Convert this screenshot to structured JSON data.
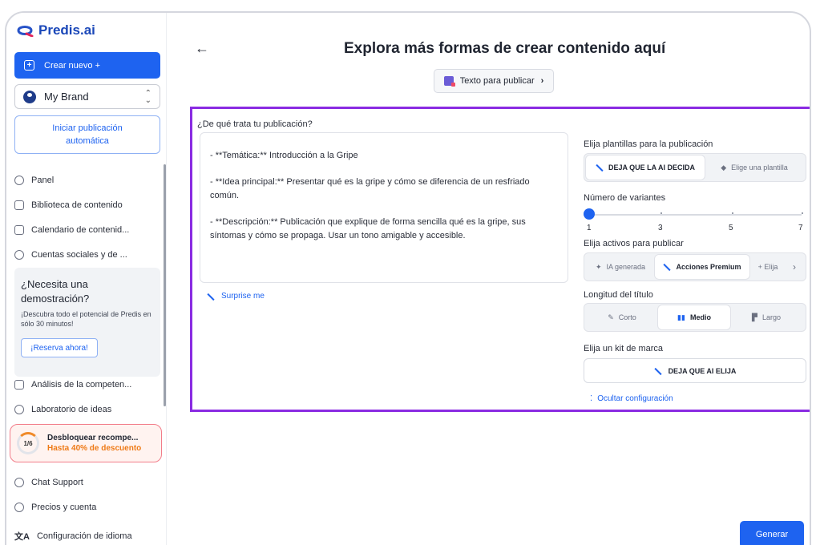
{
  "app": {
    "logo_text": "Predis.ai"
  },
  "sidebar": {
    "create_button": "Crear nuevo +",
    "brand": "My Brand",
    "auto_post": "Iniciar publicación automática",
    "items": [
      {
        "label": "Panel",
        "icon": "home-icon"
      },
      {
        "label": "Biblioteca de contenido",
        "icon": "folder-icon"
      },
      {
        "label": "Calendario de contenid...",
        "icon": "calendar-icon"
      },
      {
        "label": "Cuentas sociales y de ...",
        "icon": "accounts-icon"
      }
    ],
    "demo": {
      "title": "¿Necesita una demostración?",
      "subtitle": "¡Descubra todo el potencial de Predis en sólo 30 minutos!",
      "button": "¡Reserva ahora!"
    },
    "items2": [
      {
        "label": "Análisis de la competen...",
        "icon": "chart-icon"
      },
      {
        "label": "Laboratorio de ideas",
        "icon": "lab-icon"
      }
    ],
    "reward": {
      "progress": "1/6",
      "title": "Desbloquear recompe...",
      "subtitle": "Hasta 40% de descuento"
    },
    "items3": [
      {
        "label": "Chat Support",
        "icon": "chat-icon"
      },
      {
        "label": "Precios y cuenta",
        "icon": "billing-icon"
      },
      {
        "label": "Configuración de idioma",
        "icon": "language-icon"
      }
    ]
  },
  "main": {
    "title": "Explora más formas de crear contenido aquí",
    "type_pill": "Texto para publicar",
    "question_label": "¿De qué trata tu publicación?",
    "textarea_lines": [
      "- **Temática:** Introducción a la Gripe",
      "- **Idea principal:** Presentar qué es la gripe y cómo se diferencia de un resfriado común.",
      "- **Descripción:** Publicación que explique de forma sencilla qué es la gripe, sus síntomas y cómo se propaga. Usar un tono amigable y accesible."
    ],
    "surprise": "Surprise me",
    "templates_label": "Elija plantillas para la publicación",
    "templates_options": [
      "DEJA QUE LA AI DECIDA",
      "Elige una plantilla"
    ],
    "variants_label": "Número de variantes",
    "variants_ticks": [
      "1",
      "3",
      "5",
      "7"
    ],
    "variants_value": 1,
    "assets_label": "Elija activos para publicar",
    "assets_options": [
      "IA generada",
      "Acciones Premium",
      "+ Elija"
    ],
    "title_length_label": "Longitud del título",
    "title_length_options": [
      "Corto",
      "Medio",
      "Largo"
    ],
    "brand_kit_label": "Elija un kit de marca",
    "brand_kit_value": "DEJA QUE AI ELIJA",
    "hide_config": "Ocultar configuración",
    "generate": "Generar"
  },
  "colors": {
    "accent": "#1e63f0",
    "panel_border": "#8a2be2",
    "reward": "#ee7a16"
  }
}
